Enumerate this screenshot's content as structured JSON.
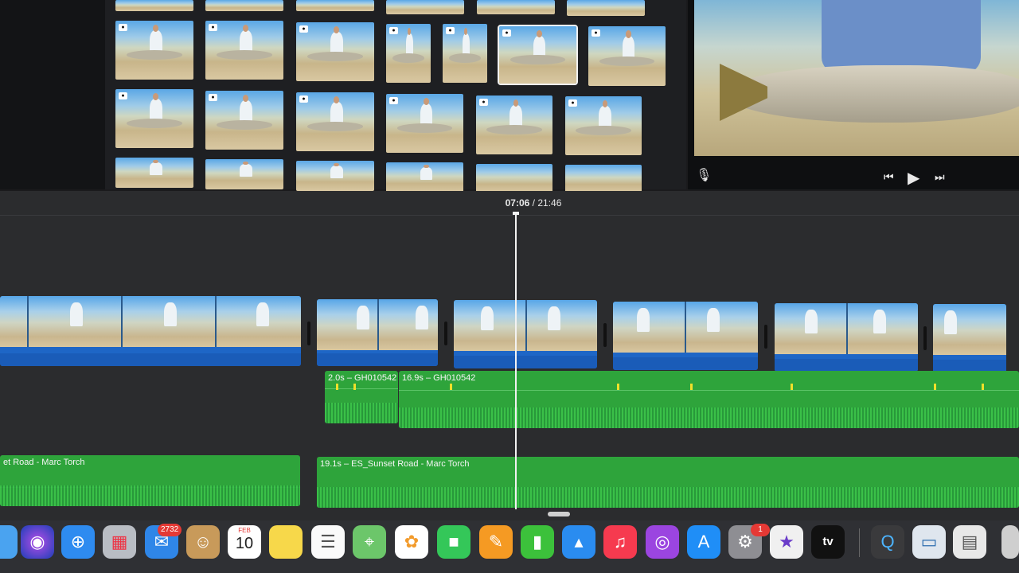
{
  "viewer": {
    "controls": {
      "mic_icon": "microphone-icon",
      "prev_icon": "skip-back-icon",
      "play_icon": "play-icon",
      "next_icon": "skip-forward-icon"
    }
  },
  "timeline": {
    "current_time": "07:06",
    "separator": "/",
    "total_time": "21:46",
    "audio_clips": [
      {
        "label": "2.0s – GH010542"
      },
      {
        "label": "16.9s – GH010542"
      }
    ],
    "music_clips": [
      {
        "label": "et Road - Marc Torch"
      },
      {
        "label": "19.1s – ES_Sunset Road - Marc Torch"
      }
    ]
  },
  "dock": {
    "apps": [
      {
        "name": "finder",
        "glyph": ""
      },
      {
        "name": "siri",
        "glyph": "◉"
      },
      {
        "name": "safari",
        "glyph": "⊕"
      },
      {
        "name": "launchpad",
        "glyph": "▦"
      },
      {
        "name": "mail",
        "glyph": "✉",
        "badge": "2732"
      },
      {
        "name": "contacts",
        "glyph": "☺"
      },
      {
        "name": "calendar",
        "month": "FEB",
        "day": "10"
      },
      {
        "name": "notes",
        "glyph": ""
      },
      {
        "name": "reminders",
        "glyph": "☰"
      },
      {
        "name": "maps",
        "glyph": "⌖"
      },
      {
        "name": "photos",
        "glyph": "✿"
      },
      {
        "name": "facetime",
        "glyph": "■"
      },
      {
        "name": "pages",
        "glyph": "✎"
      },
      {
        "name": "numbers",
        "glyph": "▮"
      },
      {
        "name": "keynote",
        "glyph": "▴"
      },
      {
        "name": "music",
        "glyph": "♫"
      },
      {
        "name": "podcasts",
        "glyph": "◎"
      },
      {
        "name": "app-store",
        "glyph": "A"
      },
      {
        "name": "system-settings",
        "glyph": "⚙",
        "badge": "1"
      },
      {
        "name": "imovie",
        "glyph": "★"
      },
      {
        "name": "tv",
        "glyph": "tv"
      },
      {
        "name": "quicktime",
        "glyph": "Q"
      },
      {
        "name": "preview",
        "glyph": "▭"
      },
      {
        "name": "folder",
        "glyph": "▤"
      },
      {
        "name": "trash",
        "glyph": ""
      }
    ]
  }
}
